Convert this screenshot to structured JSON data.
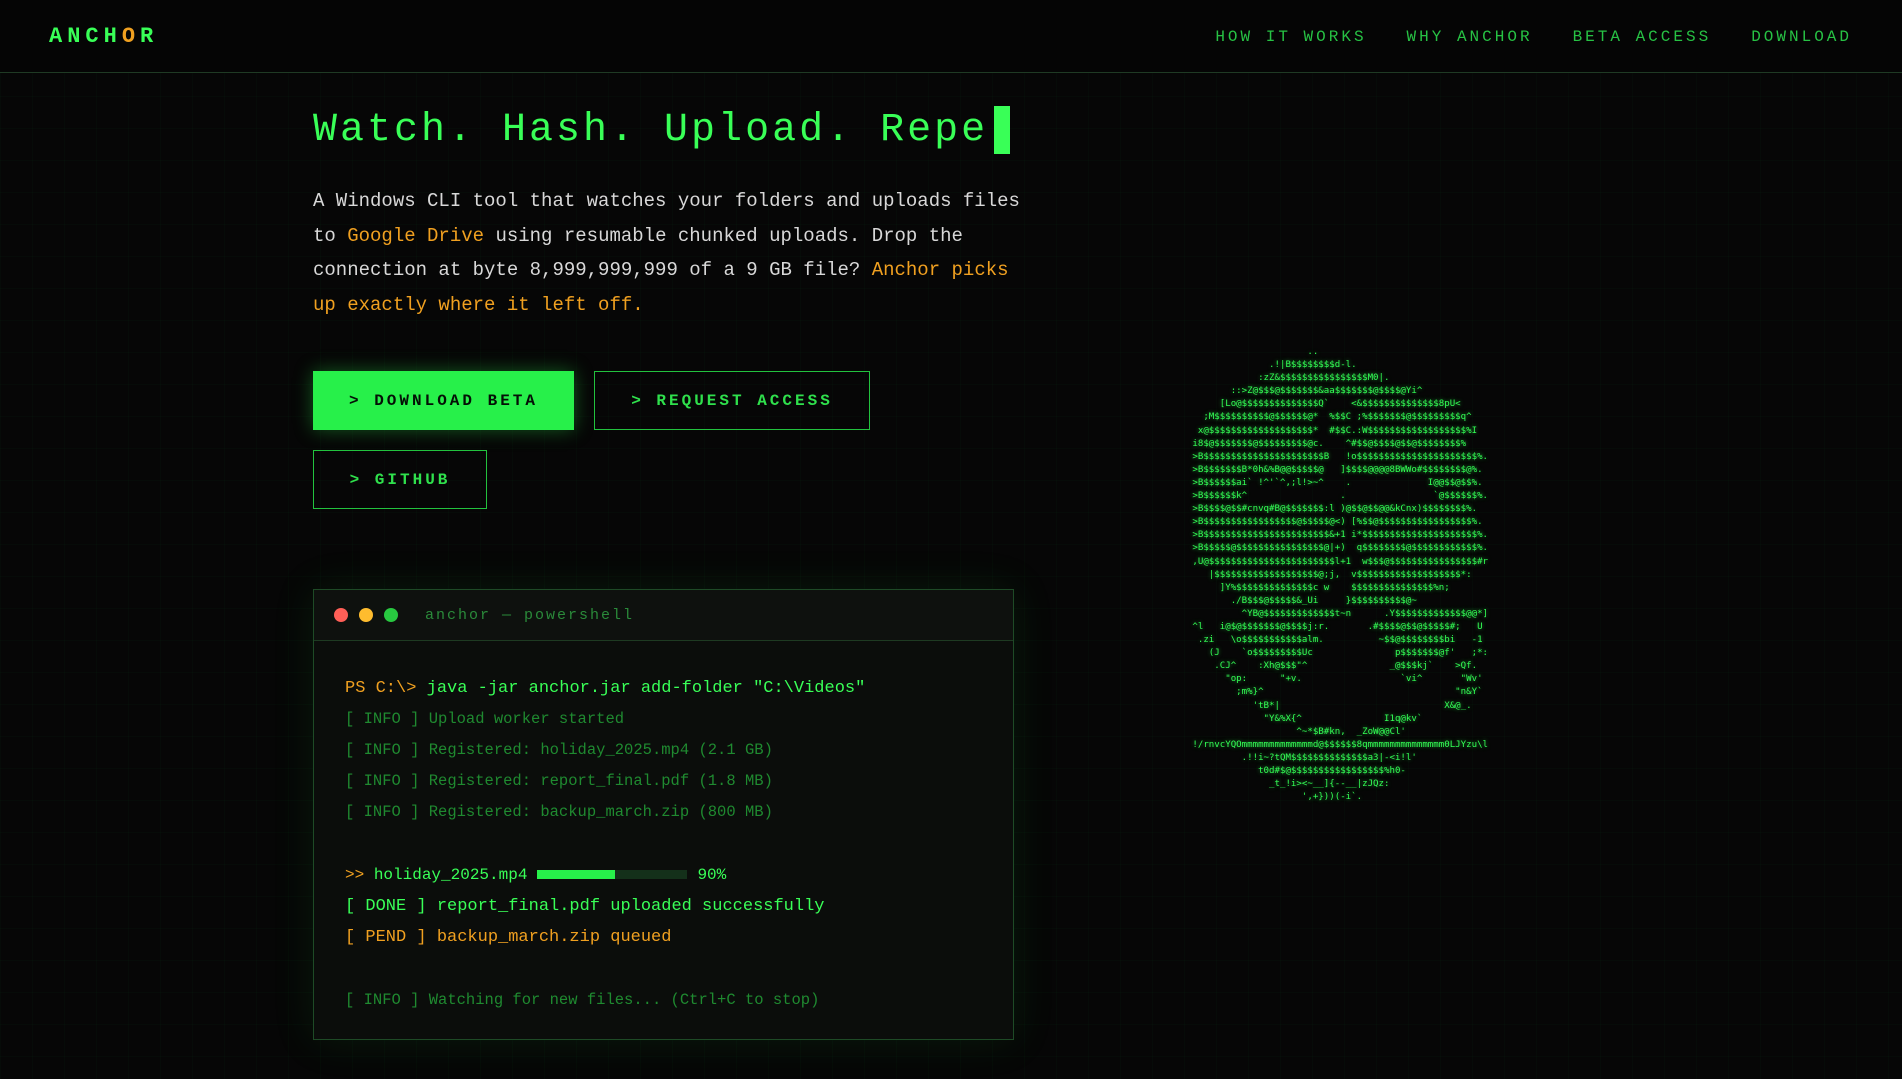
{
  "nav": {
    "logo_prefix": "ANCH",
    "logo_o": "O",
    "logo_suffix": "R",
    "links": [
      "HOW IT WORKS",
      "WHY ANCHOR",
      "BETA ACCESS",
      "DOWNLOAD"
    ]
  },
  "hero": {
    "title": "Watch. Hash. Upload. Repe",
    "desc_1": "A Windows CLI tool that watches your folders and uploads files to ",
    "desc_hl": "Google Drive",
    "desc_2": " using resumable chunked uploads. Drop the connection at byte 8,999,999,999 of a 9 GB file? ",
    "desc_hl2": "Anchor picks up exactly where it left off."
  },
  "buttons": {
    "download": "> DOWNLOAD BETA",
    "request": "> REQUEST ACCESS",
    "github": "> GITHUB"
  },
  "terminal": {
    "title": "anchor — powershell",
    "prompt": "PS C:\\> ",
    "command": "java -jar anchor.jar add-folder \"C:\\Videos\"",
    "info_lines": [
      "[ INFO ] Upload worker started",
      "[ INFO ] Registered: holiday_2025.mp4 (2.1 GB)",
      "[ INFO ] Registered: report_final.pdf (1.8 MB)",
      "[ INFO ] Registered: backup_march.zip (800 MB)"
    ],
    "progress": {
      "arrow": ">> ",
      "file": "holiday_2025.mp4",
      "percent_label": "90%",
      "fraction": 0.52
    },
    "done": "[ DONE ] report_final.pdf uploaded successfully",
    "pend": "[ PEND ] backup_march.zip queued",
    "watching": "[ INFO ] Watching for new files... (Ctrl+C to stop)"
  },
  "colors": {
    "accent_green": "#39ff57",
    "accent_orange": "#f0a020",
    "background": "#060606"
  },
  "ascii_art": [
    "                          ..",
    "                   .!|B$$$$$$$$d-l.",
    "                 :zZ&$$$$$$$$$$$$$$$$M0|.",
    "            ::>Z@$$$@$$$$$$$&aa$$$$$$$@$$$$@Yi^",
    "          [Lo@$$$$$$$$$$$$$$Q`    <&$$$$$$$$$$$$$$8pU<",
    "       ;M$$$$$$$$$$@$$$$$$@*  %$$C ;%$$$$$$$@$$$$$$$$$q^",
    "      x@$$$$$$$$$$$$$$$$$$$*  #$$C.:W$$$$$$$$$$$$$$$$$$%I",
    "     i8$@$$$$$$$@$$$$$$$$$@c.    ^#$$@$$$$@$$@$$$$$$$$%",
    "     >B$$$$$$$$$$$$$$$$$$$$$$B   !o$$$$$$$$$$$$$$$$$$$$$$%.",
    "     >B$$$$$$$B*0h&%B@@$$$$$@   ]$$$$@@@@8BWWo#$$$$$$$$@%.",
    "     >B$$$$$$ai` !^'`^,;l!>~^    .              I@@$$@$$%.",
    "     >B$$$$$$k^                 .                `@$$$$$$%.",
    "     >B$$$$@$$#cnvq#B@$$$$$$$:l )@$$@$$@@&kCnx)$$$$$$$$%.",
    "     >B$$$$$$$$$$$$$$$$$@$$$$$@<) [%$$@$$$$$$$$$$$$$$$$$%.",
    "     >B$$$$$$$$$$$$$$$$$$$$$$$&+1 i*$$$$$$$$$$$$$$$$$$$$$%.",
    "     >B$$$$$@$$$$$$$$$$$$$$$$@|+)  q$$$$$$$$@$$$$$$$$$$$$%.",
    "     ,U@$$$$$$$$$$$$$$$$$$$$$$$l+1  w$$$@$$$$$$$$$$$$$$$$#r",
    "        |$$$$$$$$$$$$$$$$$$$@;j,  v$$$$$$$$$$$$$$$$$$$*:",
    "          ]Y%$$$$$$$$$$$$$$c w    $$$$$$$$$$$$$$$%n;",
    "            ./B$$$@$$$$$&_Ui     }$$$$$$$$$$@~",
    "              ^YB@$$$$$$$$$$$$$t~n      .Y$$$$$$$$$$$$$@@*]",
    "     ^l   i@$@$$$$$$$@$$$$j:r.       .#$$$$@$$@$$$$$#;   U",
    "      .zi   \\o$$$$$$$$$$$alm.          ~$$@$$$$$$$$bi   -1",
    "        (J    `o$$$$$$$$$Uc               p$$$$$$$@f'   ;*:",
    "         .CJ^    :Xh@$$$\"^               _@$$$kj`    >Qf.",
    "           \"op:      \"+v.                  `vi^       \"Wv'",
    "             ;m%}^                                   \"n&Y`",
    "                'tB*|                              X&@_.",
    "                  \"Y&%X{^               I1q@kv`",
    "                        ^~*$B#kn,  _ZoW@@Cl'",
    "     !/rnvcYQOmmmmmmmmmmmmmd@$$$$$$8qmmmmmmmmmmmmmm0LJYzu\\l",
    "              .!!i~?tQM$$$$$$$$$$$$$$a3|-<i!l'",
    "                 t0d#$@$$$$$$$$$$$$$$$$$%h0-",
    "                   _t_!i><~__]{--__|zJQz:",
    "                         ',+}))(-i`."
  ]
}
